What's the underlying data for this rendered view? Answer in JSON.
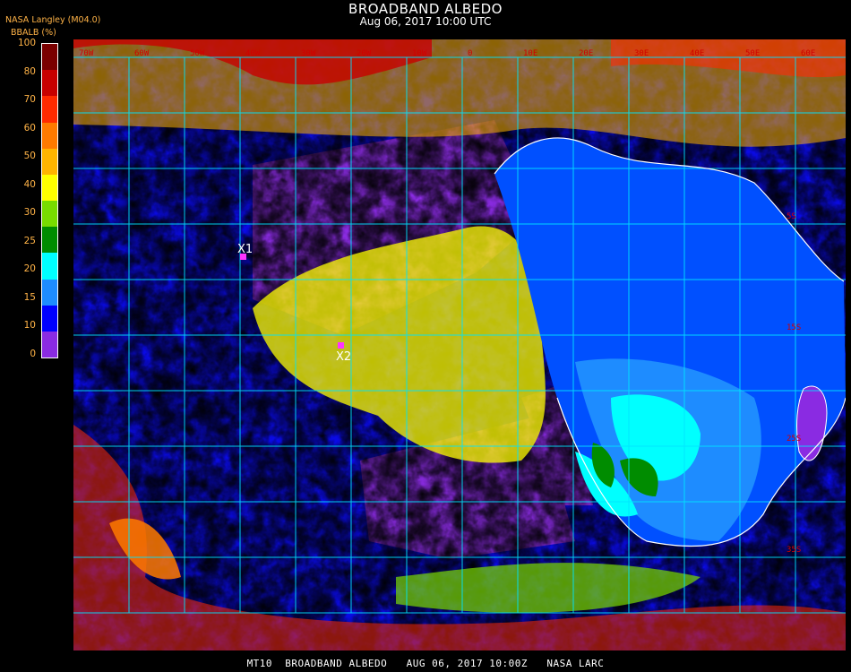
{
  "header": {
    "title": "BROADBAND ALBEDO",
    "subtitle": "Aug 06, 2017 10:00 UTC",
    "source": "NASA Langley (M04.0)",
    "unit_label": "BBALB (%)"
  },
  "colorbar": {
    "ticks": [
      "100",
      "80",
      "70",
      "60",
      "50",
      "40",
      "30",
      "25",
      "20",
      "15",
      "10",
      "0"
    ],
    "colors": [
      "#7a0000",
      "#c80000",
      "#ff2a00",
      "#ff7a00",
      "#ffb400",
      "#ffff00",
      "#78dc00",
      "#008c00",
      "#00ffff",
      "#1e8cff",
      "#0000ff",
      "#8a2be2"
    ]
  },
  "markers": [
    {
      "label": "X1",
      "color": "#ff33ff"
    },
    {
      "label": "X2",
      "color": "#ff33ff"
    }
  ],
  "grid": {
    "top_labels": [
      "70W",
      "60W",
      "50W",
      "40W",
      "30W",
      "20W",
      "10W",
      "0",
      "10E",
      "20E",
      "30E",
      "40E",
      "50E",
      "60E"
    ],
    "right_labels": [
      "5S",
      "15S",
      "25S",
      "35S"
    ],
    "grid_color": "#00e5ff"
  },
  "footer": {
    "text": "MT10  BROADBAND ALBEDO   AUG 06, 2017 10:00Z   NASA LARC"
  }
}
